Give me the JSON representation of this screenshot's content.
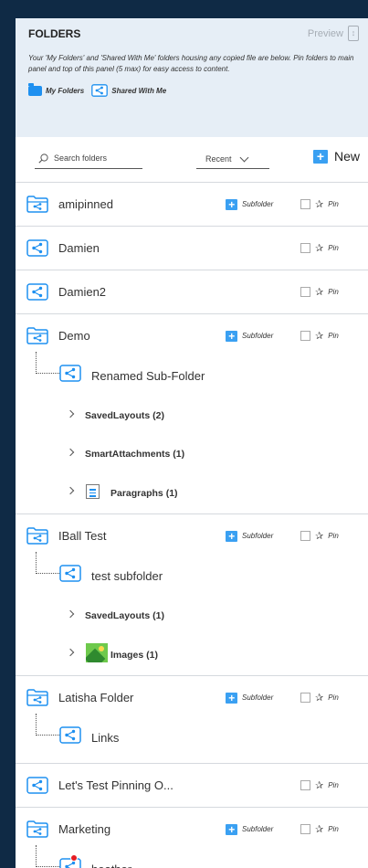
{
  "header": {
    "title": "FOLDERS",
    "preview_label": "Preview",
    "description": "Your 'My Folders' and 'Shared With Me' folders housing any copied file are below. Pin folders to main panel and top of this panel (5 max) for easy access to content.",
    "legend_my_folders": "My Folders",
    "legend_shared": "Shared With Me"
  },
  "toolbar": {
    "search_placeholder": "Search folders",
    "sort_value": "Recent",
    "new_label": "New"
  },
  "actions": {
    "subfolder_label": "Subfolder",
    "pin_label": "Pin"
  },
  "folders": [
    {
      "name": "amipinned"
    },
    {
      "name": "Damien"
    },
    {
      "name": "Damien2"
    },
    {
      "name": "Demo",
      "sub": "Renamed Sub-Folder",
      "items": [
        "SavedLayouts (2)",
        "SmartAttachments (1)",
        "Paragraphs (1)"
      ]
    },
    {
      "name": "IBall Test",
      "sub": "test subfolder",
      "items": [
        "SavedLayouts (1)",
        "Images (1)"
      ]
    },
    {
      "name": "Latisha Folder",
      "sub": "Links"
    },
    {
      "name": "Let's Test Pinning O..."
    },
    {
      "name": "Marketing",
      "sub": "heather"
    }
  ],
  "colors": {
    "accent": "#1e90f0",
    "frame": "#0f2a45",
    "header_bg": "#e6eef6"
  }
}
